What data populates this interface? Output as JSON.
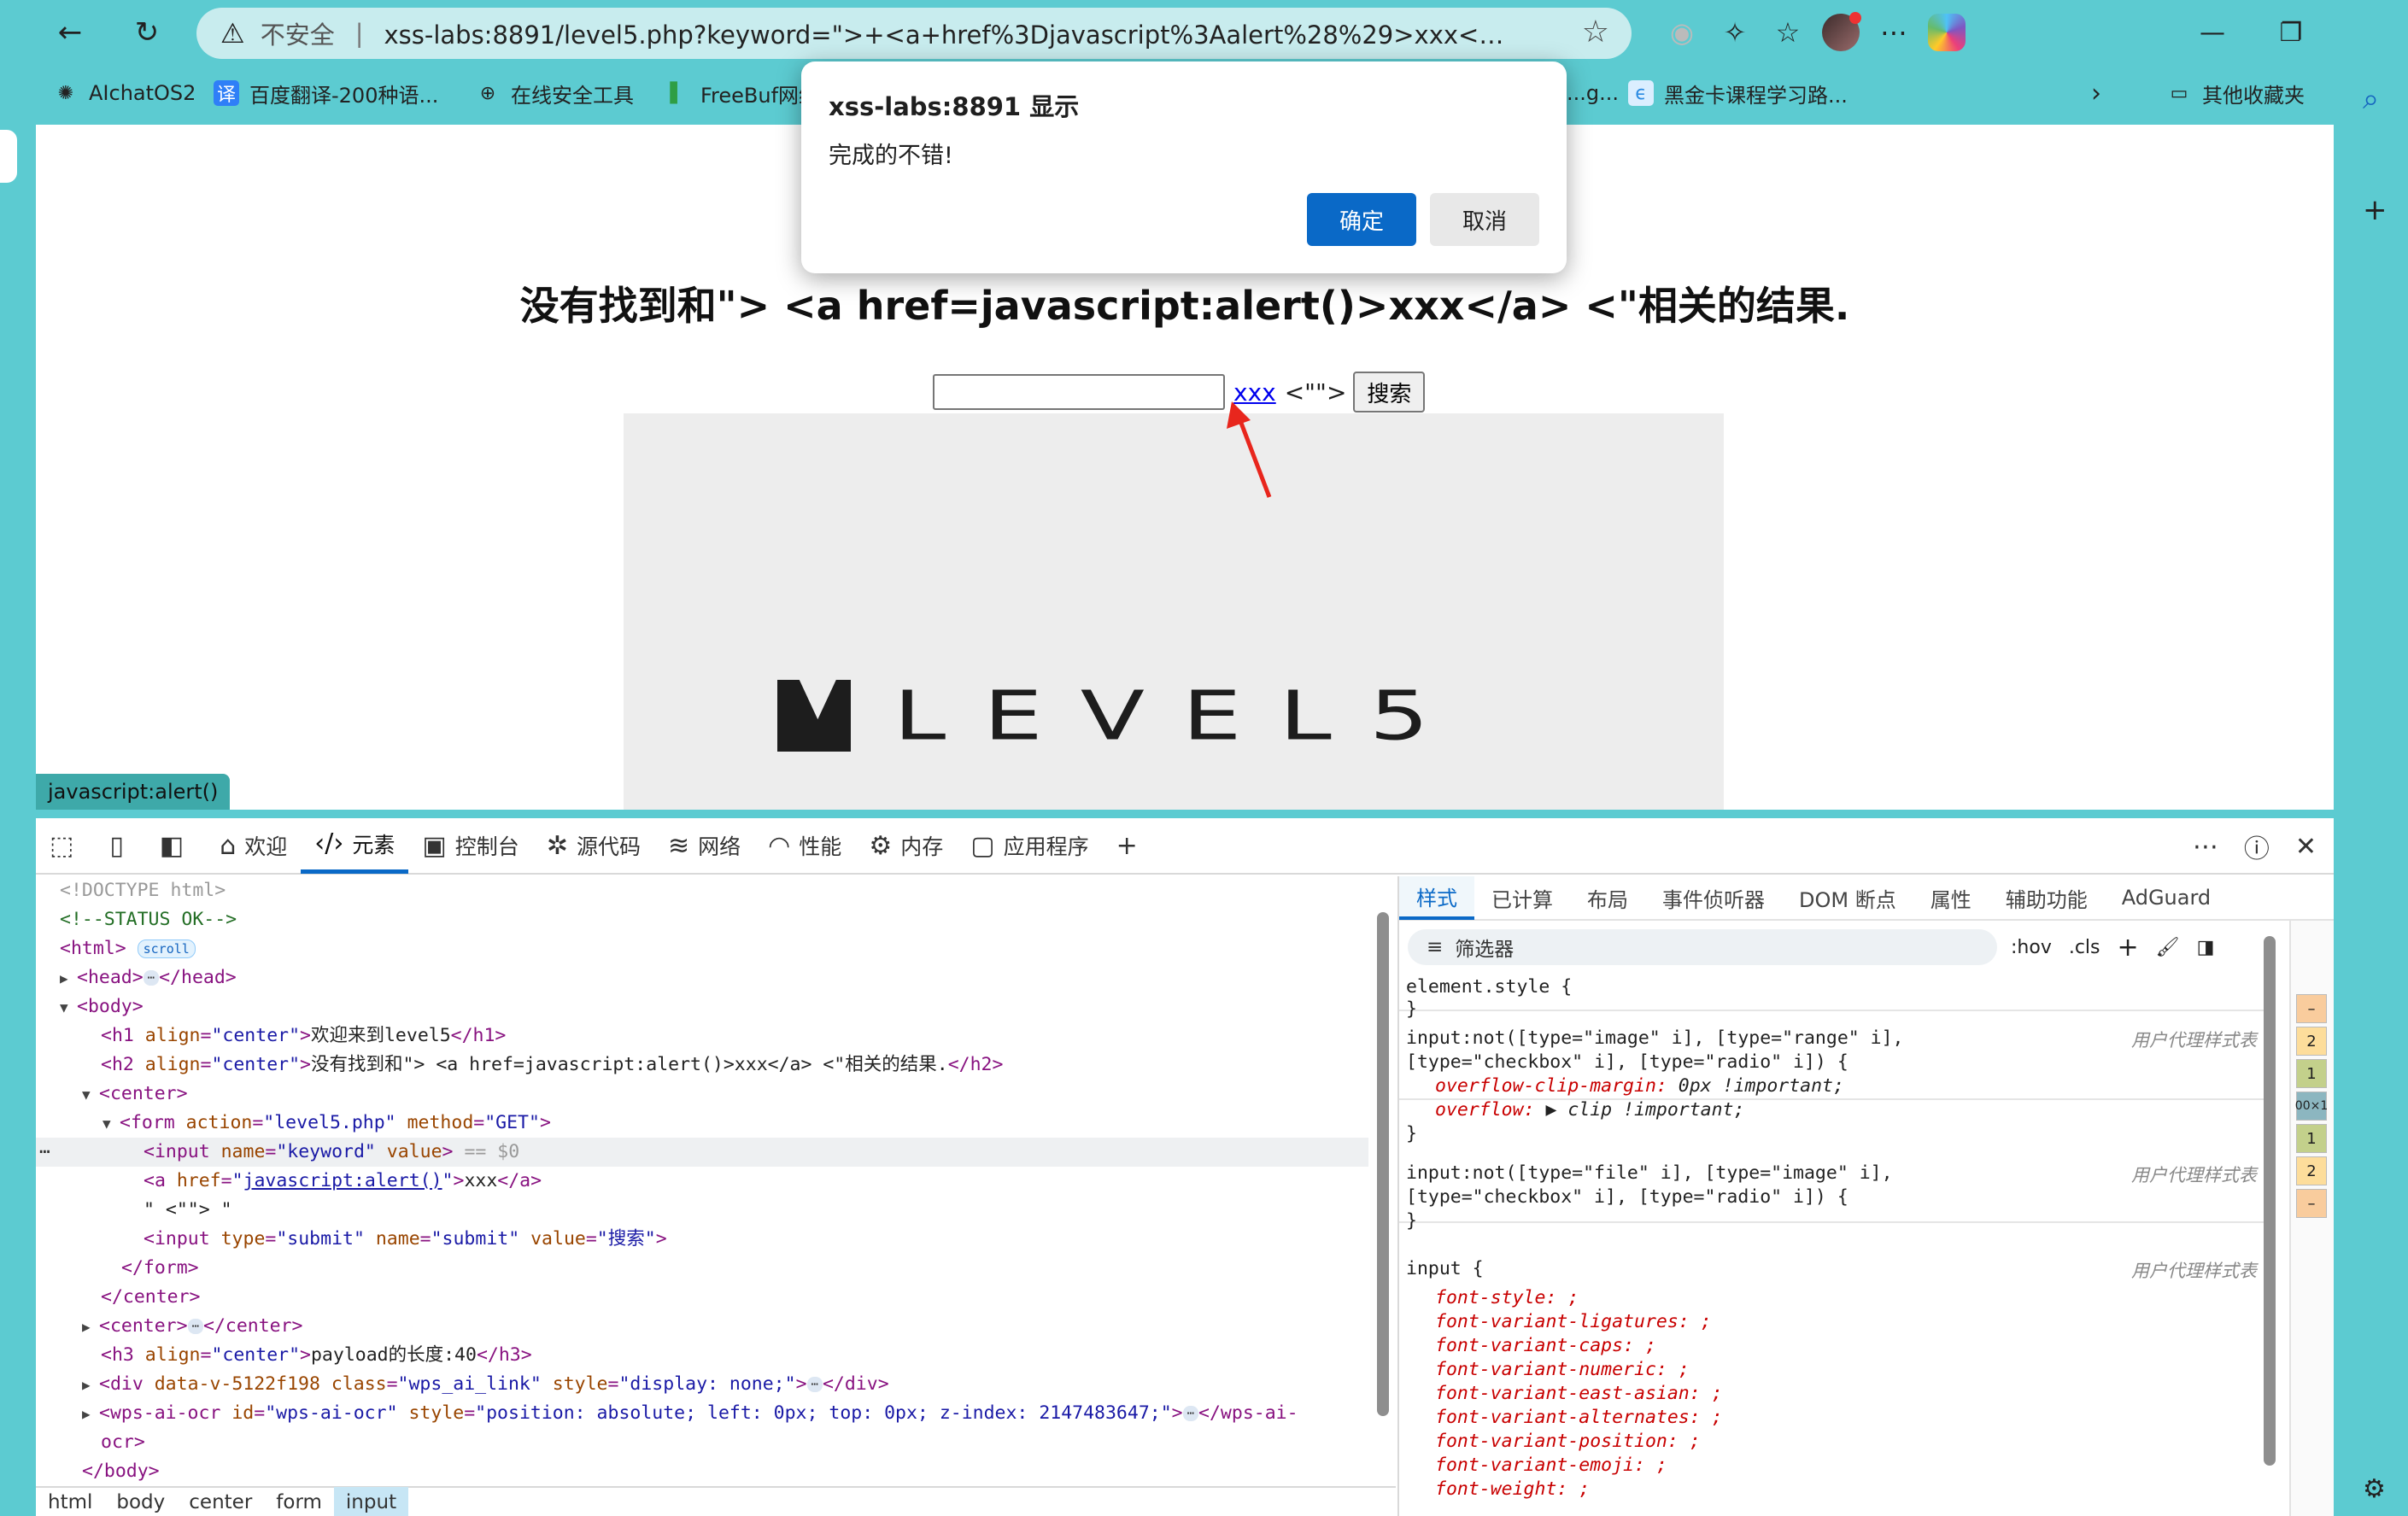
{
  "browser": {
    "security_warning": "不安全",
    "address": "xss-labs:8891/level5.php?keyword=\">+<a+href%3Djavascript%3Aalert%28%29>xxx<%2Fa>+<\"&submit=搜...",
    "bookmarks": [
      {
        "label": "AIchatOS2",
        "icon": "openai-icon",
        "color": "#222222"
      },
      {
        "label": "百度翻译-200种语...",
        "icon": "translate-icon",
        "color": "#2f7ff7"
      },
      {
        "label": "在线安全工具",
        "icon": "globe-icon",
        "color": "#222222"
      },
      {
        "label": "FreeBuf网络",
        "icon": "freebuf-icon",
        "color": "#2e9e44"
      },
      {
        "label": "...g...",
        "icon": "page-icon",
        "color": "#666666"
      },
      {
        "label": "黑金卡课程学习路...",
        "icon": "course-icon",
        "color": "#2b8be2"
      },
      {
        "label": "其他收藏夹",
        "icon": "folder-icon",
        "color": "#222222"
      }
    ]
  },
  "page": {
    "heading": "没有找到和\"> <a href=javascript:alert()>xxx</a> <\"相关的结果.",
    "search_value": "",
    "link_text": "xxx",
    "trailing_text": "<\"\">",
    "search_button": "搜索",
    "logo_text": "LEVEL5",
    "status_url": "javascript:alert()"
  },
  "dialog": {
    "title": "xss-labs:8891 显示",
    "message": "完成的不错!",
    "ok": "确定",
    "cancel": "取消"
  },
  "devtools": {
    "tabs": [
      {
        "label": "",
        "icon": "inspect-icon"
      },
      {
        "label": "",
        "icon": "device-icon"
      },
      {
        "label": "",
        "icon": "dock-icon"
      },
      {
        "label": "欢迎",
        "icon": "home-icon"
      },
      {
        "label": "元素",
        "icon": "code-icon",
        "active": true
      },
      {
        "label": "控制台",
        "icon": "console-icon"
      },
      {
        "label": "源代码",
        "icon": "bug-icon"
      },
      {
        "label": "网络",
        "icon": "wifi-icon"
      },
      {
        "label": "性能",
        "icon": "gauge-icon"
      },
      {
        "label": "内存",
        "icon": "chip-icon"
      },
      {
        "label": "应用程序",
        "icon": "app-icon"
      }
    ],
    "dom": {
      "doctype": "<!DOCTYPE html>",
      "comment": "<!--STATUS OK-->",
      "html_badge": "scroll",
      "h1_text": "欢迎来到level5",
      "h2_text": "没有找到和\"> <a href=javascript:alert()>xxx</a> <\"相关的结果.",
      "form_action": "\"level5.php\"",
      "form_method": "\"GET\"",
      "input_name": "\"keyword\"",
      "input_value": "value",
      "sel_marker": "== $0",
      "a_href": "javascript:alert()",
      "a_text": "xxx",
      "text_node": "\" <\"\"> \"",
      "submit_value": "\"搜索\"",
      "h3_text": "payload的长度:40",
      "div_attr": "data-v-5122f198",
      "div_class": "\"wps_ai_link\"",
      "div_style": "\"display: none;\"",
      "ocr_id": "\"wps-ai-ocr\"",
      "ocr_style": "\"position: absolute; left: 0px; top: 0px; z-index: 2147483647;\""
    },
    "breadcrumbs": [
      "html",
      "body",
      "center",
      "form",
      "input"
    ],
    "styles_tabs": [
      "样式",
      "已计算",
      "布局",
      "事件侦听器",
      "DOM 断点",
      "属性",
      "辅助功能",
      "AdGuard"
    ],
    "filter_placeholder": "筛选器",
    "filter_tools": [
      ":hov",
      ".cls"
    ],
    "ua_label": "用户代理样式表",
    "rules": {
      "element_style": "element.style {",
      "r1_sel_a": "input:not([type=\"image\" i], [type=\"range\" i],",
      "r1_sel_b": "[type=\"checkbox\" i], [type=\"radio\" i]) {",
      "r1_p1": "overflow-clip-margin",
      "r1_v1": "0px !important;",
      "r1_p2": "overflow",
      "r1_v2": "▶ clip !important;",
      "r2_sel_a": "input:not([type=\"file\" i], [type=\"image\" i],",
      "r2_sel_b": "[type=\"checkbox\" i], [type=\"radio\" i]) {",
      "r3_sel": "input {",
      "r3_props": [
        "font-style",
        "font-variant-ligatures",
        "font-variant-caps",
        "font-variant-numeric",
        "font-variant-east-asian",
        "font-variant-alternates",
        "font-variant-position",
        "font-variant-emoji",
        "font-weight"
      ]
    },
    "box_chips": [
      "–",
      "2",
      "1",
      "00×1",
      "1",
      "2",
      "–"
    ]
  }
}
